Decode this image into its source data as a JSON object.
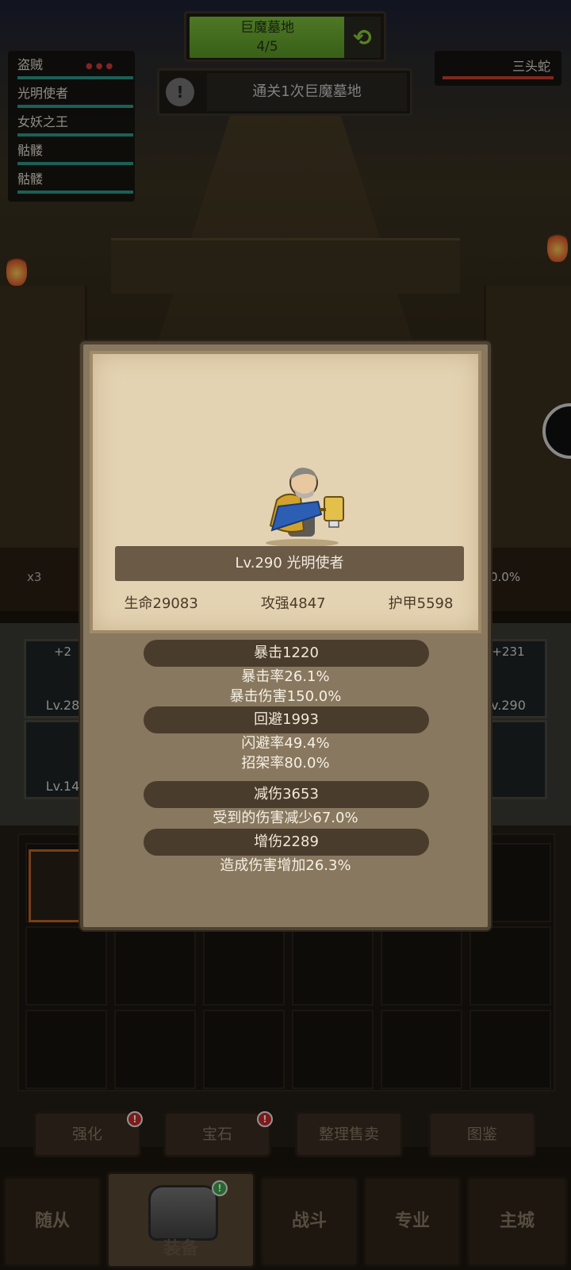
{
  "stage": {
    "name": "巨魔墓地",
    "progress": "4/5"
  },
  "quest": {
    "text": "通关1次巨魔墓地"
  },
  "party": [
    {
      "name": "盗贼"
    },
    {
      "name": "光明使者"
    },
    {
      "name": "女妖之王"
    },
    {
      "name": "骷髅"
    },
    {
      "name": "骷髅"
    }
  ],
  "enemy": {
    "name": "三头蛇"
  },
  "battle": {
    "multiplier": "x3",
    "percent": "0.0%"
  },
  "equip_slots": [
    {
      "plus": "+2",
      "level": "Lv.28"
    },
    {
      "plus": "+231",
      "level": "v.290"
    },
    {
      "plus": "",
      "level": "Lv.14"
    }
  ],
  "actions": {
    "enhance": "强化",
    "gems": "宝石",
    "sort_sell": "整理售卖",
    "codex": "图鉴"
  },
  "nav": {
    "followers": "随从",
    "equipment": "装备",
    "battle": "战斗",
    "profession": "专业",
    "main_city": "主城"
  },
  "hero": {
    "title": "Lv.290 光明使者",
    "hp": "生命29083",
    "attack": "攻强4847",
    "armor": "护甲5598"
  },
  "stats": {
    "crit": {
      "header": "暴击1220",
      "lines": [
        "暴击率26.1%",
        "暴击伤害150.0%"
      ]
    },
    "dodge": {
      "header": "回避1993",
      "lines": [
        "闪避率49.4%",
        "招架率80.0%"
      ]
    },
    "reduce": {
      "header": "减伤3653",
      "lines": [
        "受到的伤害减少67.0%"
      ]
    },
    "increase": {
      "header": "增伤2289",
      "lines": [
        "造成伤害增加26.3%"
      ]
    }
  },
  "colors": {
    "stage_green": "#6fb232",
    "hp_bar": "#2e9a8c",
    "enemy_bar": "#c9432f",
    "parchment": "#e4d3b2",
    "modal": "#88785f"
  }
}
